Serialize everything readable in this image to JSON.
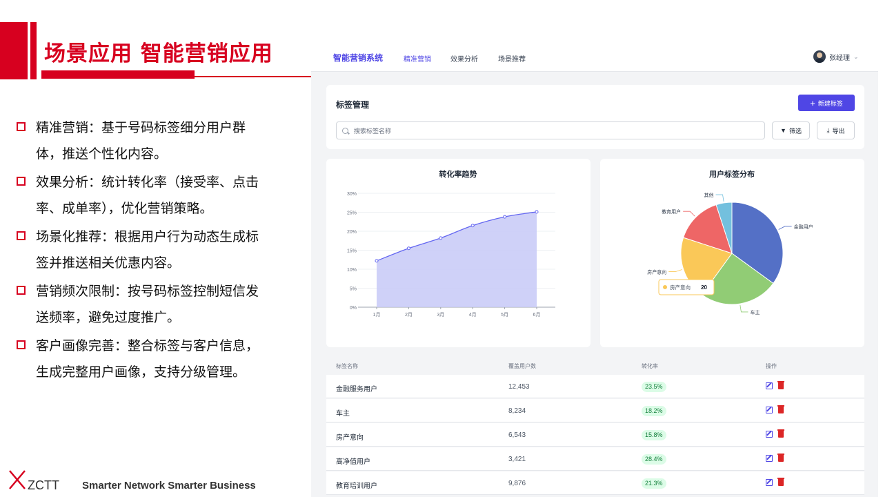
{
  "slide": {
    "title": "场景应用 智能营销应用",
    "bullets": [
      "精准营销：基于号码标签细分用户群体，推送个性化内容。",
      "效果分析：统计转化率（接受率、点击率、成单率），优化营销策略。",
      "场景化推荐：根据用户行为动态生成标签并推送相关优惠内容。",
      "营销频次限制：按号码标签控制短信发送频率，避免过度推广。",
      "客户画像完善：整合标签与客户信息，生成完整用户画像，支持分级管理。"
    ],
    "logo_text": "ZCTT",
    "slogan": "Smarter Network  Smarter Business",
    "accent_color": "#d7001f"
  },
  "app": {
    "brand": "智能营销系统",
    "nav": [
      "精准营销",
      "效果分析",
      "场景推荐"
    ],
    "user_name": "张经理",
    "accent_color": "#4f46e5",
    "tag_panel": {
      "title": "标签管理",
      "new_button": "新建标签",
      "search_placeholder": "搜索标签名称",
      "filter_button": "筛选",
      "export_button": "导出"
    },
    "table": {
      "headers": [
        "标签名称",
        "覆盖用户数",
        "转化率",
        "操作"
      ],
      "rows": [
        {
          "name": "金融服务用户",
          "users": "12,453",
          "rate": "23.5%"
        },
        {
          "name": "车主",
          "users": "8,234",
          "rate": "18.2%"
        },
        {
          "name": "房产意向",
          "users": "6,543",
          "rate": "15.8%"
        },
        {
          "name": "高净值用户",
          "users": "3,421",
          "rate": "28.4%"
        },
        {
          "name": "教育培训用户",
          "users": "9,876",
          "rate": "21.3%"
        }
      ]
    }
  },
  "chart_data": [
    {
      "type": "area",
      "title": "转化率趋势",
      "categories": [
        "1月",
        "2月",
        "3月",
        "4月",
        "5月",
        "6月"
      ],
      "values": [
        12.2,
        15.5,
        18.2,
        21.5,
        23.8,
        25.1
      ],
      "ylim": [
        0,
        30
      ],
      "yticks": [
        "0%",
        "5%",
        "10%",
        "15%",
        "20%",
        "25%",
        "30%"
      ],
      "color": "#6366f1",
      "fill_color": "#c7c9f7",
      "grid": true
    },
    {
      "type": "pie",
      "title": "用户标签分布",
      "slices": [
        {
          "label": "金融用户",
          "value": 35,
          "color": "#5470c6"
        },
        {
          "label": "车主",
          "value": 25,
          "color": "#91cc75"
        },
        {
          "label": "房产意向",
          "value": 20,
          "color": "#fac858"
        },
        {
          "label": "教育用户",
          "value": 15,
          "color": "#ee6666"
        },
        {
          "label": "其他",
          "value": 5,
          "color": "#73c0de"
        }
      ],
      "tooltip": {
        "label": "房产意向",
        "value": "20"
      }
    }
  ]
}
